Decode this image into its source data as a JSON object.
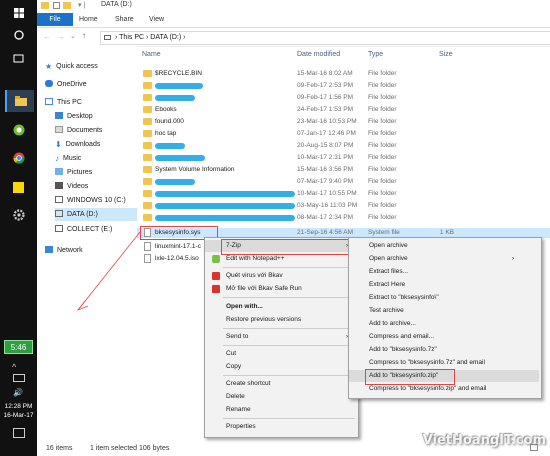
{
  "taskbar": {
    "icons": [
      "power-icon",
      "search-icon",
      "task-view-icon",
      "file-explorer-icon",
      "torrent-icon",
      "chrome-icon",
      "sticky-notes-icon",
      "settings-icon"
    ],
    "battery": "5:46",
    "time": "12:28 PM",
    "date": "16-Mar-17"
  },
  "window": {
    "title": "DATA (D:)"
  },
  "ribbon": {
    "tabs": [
      "File",
      "Home",
      "Share",
      "View"
    ]
  },
  "address": {
    "path": [
      "This PC",
      "DATA (D:)"
    ]
  },
  "navpane": {
    "items": [
      {
        "label": "Quick access",
        "icon": "star-icon",
        "indent": 0
      },
      {
        "label": "OneDrive",
        "icon": "cloud-icon",
        "indent": 0
      },
      {
        "label": "This PC",
        "icon": "computer-icon",
        "indent": 0
      },
      {
        "label": "Desktop",
        "icon": "desktop-icon",
        "indent": 1
      },
      {
        "label": "Documents",
        "icon": "documents-icon",
        "indent": 1
      },
      {
        "label": "Downloads",
        "icon": "download-icon",
        "indent": 1
      },
      {
        "label": "Music",
        "icon": "music-icon",
        "indent": 1
      },
      {
        "label": "Pictures",
        "icon": "pictures-icon",
        "indent": 1
      },
      {
        "label": "Videos",
        "icon": "videos-icon",
        "indent": 1
      },
      {
        "label": "WINDOWS 10 (C:)",
        "icon": "drive-icon",
        "indent": 1
      },
      {
        "label": "DATA (D:)",
        "icon": "drive-icon",
        "indent": 1,
        "selected": true
      },
      {
        "label": "COLLECT (E:)",
        "icon": "drive-icon",
        "indent": 1
      },
      {
        "label": "Network",
        "icon": "network-icon",
        "indent": 0
      }
    ]
  },
  "files": {
    "headers": [
      "Name",
      "Date modified",
      "Type",
      "Size"
    ],
    "rows": [
      {
        "name": "$RECYCLE.BIN",
        "date": "15-Mar-16 8:02 AM",
        "type": "File folder",
        "size": "",
        "kind": "folder"
      },
      {
        "name": "",
        "date": "09-Feb-17 2:53 PM",
        "type": "File folder",
        "size": "",
        "kind": "folder",
        "redacted": true
      },
      {
        "name": "",
        "date": "09-Feb-17 1:56 PM",
        "type": "File folder",
        "size": "",
        "kind": "folder",
        "redacted": true
      },
      {
        "name": "Ebooks",
        "date": "24-Feb-17 1:53 PM",
        "type": "File folder",
        "size": "",
        "kind": "folder"
      },
      {
        "name": "found.000",
        "date": "23-Mar-16 10:53 PM",
        "type": "File folder",
        "size": "",
        "kind": "folder"
      },
      {
        "name": "hoc tap",
        "date": "07-Jan-17 12:46 PM",
        "type": "File folder",
        "size": "",
        "kind": "folder"
      },
      {
        "name": "",
        "date": "20-Aug-15 8:07 PM",
        "type": "File folder",
        "size": "",
        "kind": "folder",
        "redacted": true
      },
      {
        "name": "",
        "date": "10-Mar-17 2:31 PM",
        "type": "File folder",
        "size": "",
        "kind": "folder",
        "redacted": true
      },
      {
        "name": "System Volume Information",
        "date": "15-Mar-16 3:56 PM",
        "type": "File folder",
        "size": "",
        "kind": "folder"
      },
      {
        "name": "",
        "date": "07-Mar-17 9:40 PM",
        "type": "File folder",
        "size": "",
        "kind": "folder",
        "redacted": true
      },
      {
        "name": "",
        "date": "10-Mar-17 10:55 PM",
        "type": "File folder",
        "size": "",
        "kind": "folder",
        "redacted": true
      },
      {
        "name": "",
        "date": "03-May-16 11:03 PM",
        "type": "File folder",
        "size": "",
        "kind": "folder",
        "redacted": true
      },
      {
        "name": "",
        "date": "08-Mar-17 2:34 PM",
        "type": "File folder",
        "size": "",
        "kind": "folder",
        "redacted": true
      },
      {
        "name": "bksesysinfo.sys",
        "date": "21-Sep-16 4:56 AM",
        "type": "System file",
        "size": "1 KB",
        "kind": "file",
        "selected": true
      },
      {
        "name": "linuxmint-17.1-c",
        "date": "",
        "type": "",
        "size": "",
        "kind": "file"
      },
      {
        "name": "lxle-12.04.5.iso",
        "date": "",
        "type": "",
        "size": "",
        "kind": "file"
      }
    ]
  },
  "status": {
    "count": "16 items",
    "selected": "1 item selected  106 bytes"
  },
  "context_menu": {
    "items": [
      "7-Zip",
      "Edit with Notepad++",
      "Quét virus với Bkav",
      "Mở file với Bkav Safe Run",
      "Open with...",
      "Restore previous versions",
      "Send to",
      "Cut",
      "Copy",
      "Create shortcut",
      "Delete",
      "Rename",
      "Properties"
    ]
  },
  "zip_menu": {
    "items": [
      "Open archive",
      "Open archive",
      "Extract files...",
      "Extract Here",
      "Extract to \"bksesysinfo\\\"",
      "Test archive",
      "Add to archive...",
      "Compress and email...",
      "Add to \"bksesysinfo.7z\"",
      "Compress to \"bksesysinfo.7z\" and email",
      "Add to \"bksesysinfo.zip\"",
      "Compress to \"bksesysinfo.zip\" and email"
    ]
  },
  "watermark": "VietHoangIT.com"
}
